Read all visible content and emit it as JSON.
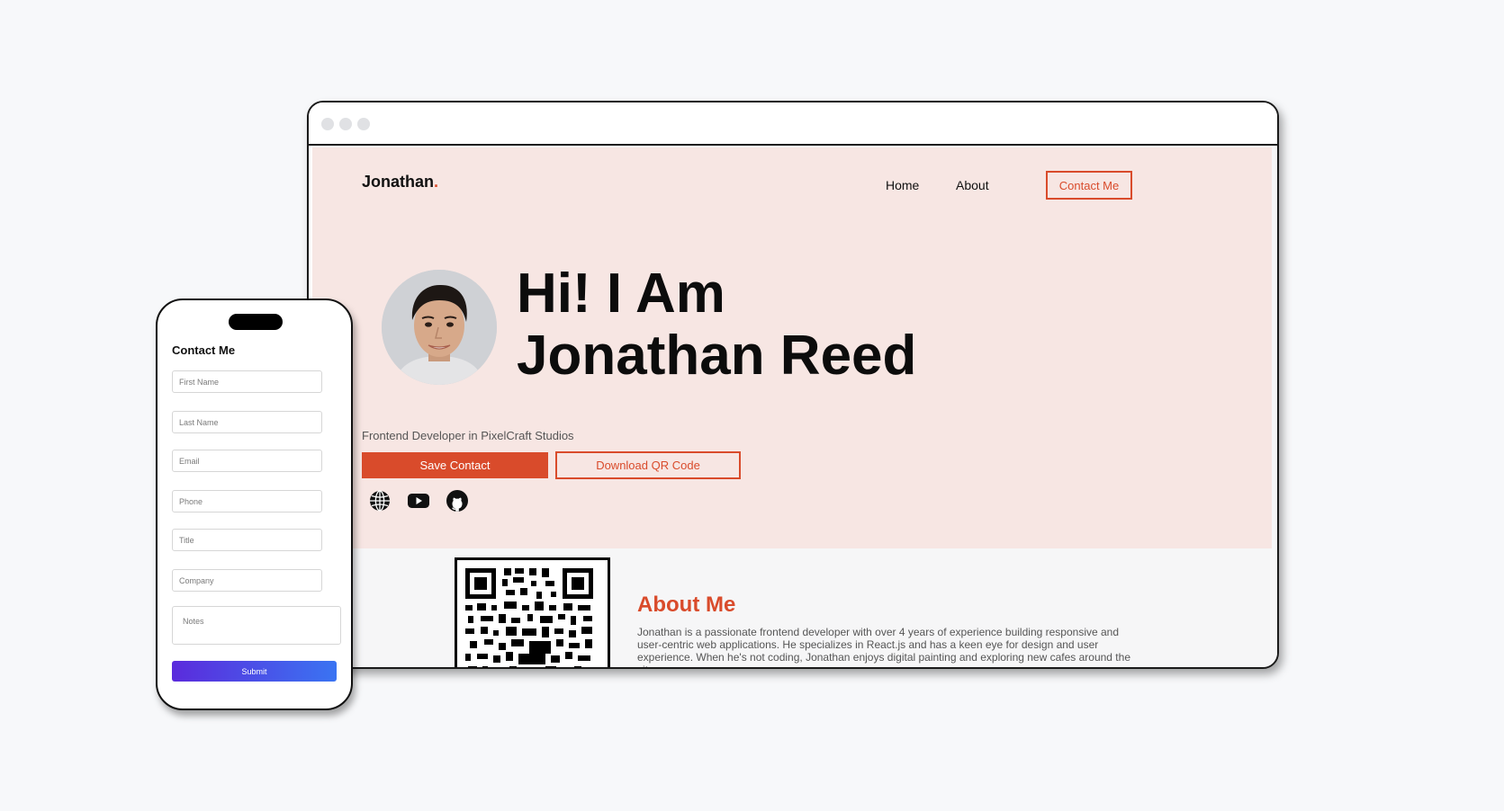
{
  "site": {
    "logo_text": "Jonathan",
    "logo_dot": ".",
    "nav": {
      "home": "Home",
      "about": "About",
      "contact": "Contact Me"
    }
  },
  "hero": {
    "title_line1": "Hi! I Am",
    "title_line2": "Jonathan Reed",
    "subtitle": "Frontend Developer in PixelCraft Studios",
    "save_label": "Save Contact",
    "qr_label": "Download QR Code",
    "socials": [
      "globe-icon",
      "youtube-icon",
      "github-icon"
    ]
  },
  "about": {
    "title": "About Me",
    "text": "Jonathan is a passionate frontend developer with over 4 years of experience building responsive and user-centric web applications. He specializes in React.js and has a keen eye for design and user experience. When he's not coding, Jonathan enjoys digital painting and exploring new cafes around the city."
  },
  "form": {
    "title": "Contact Me",
    "first_name_placeholder": "First Name",
    "last_name_placeholder": "Last Name",
    "email_placeholder": "Email",
    "phone_placeholder": "Phone",
    "title_placeholder": "Title",
    "company_placeholder": "Company",
    "notes_placeholder": "Notes",
    "submit_label": "Submit"
  },
  "colors": {
    "accent": "#d94b2b",
    "hero_bg": "#f7e6e3",
    "submit_gradient_start": "#5b2bdc",
    "submit_gradient_end": "#3a74f2"
  }
}
